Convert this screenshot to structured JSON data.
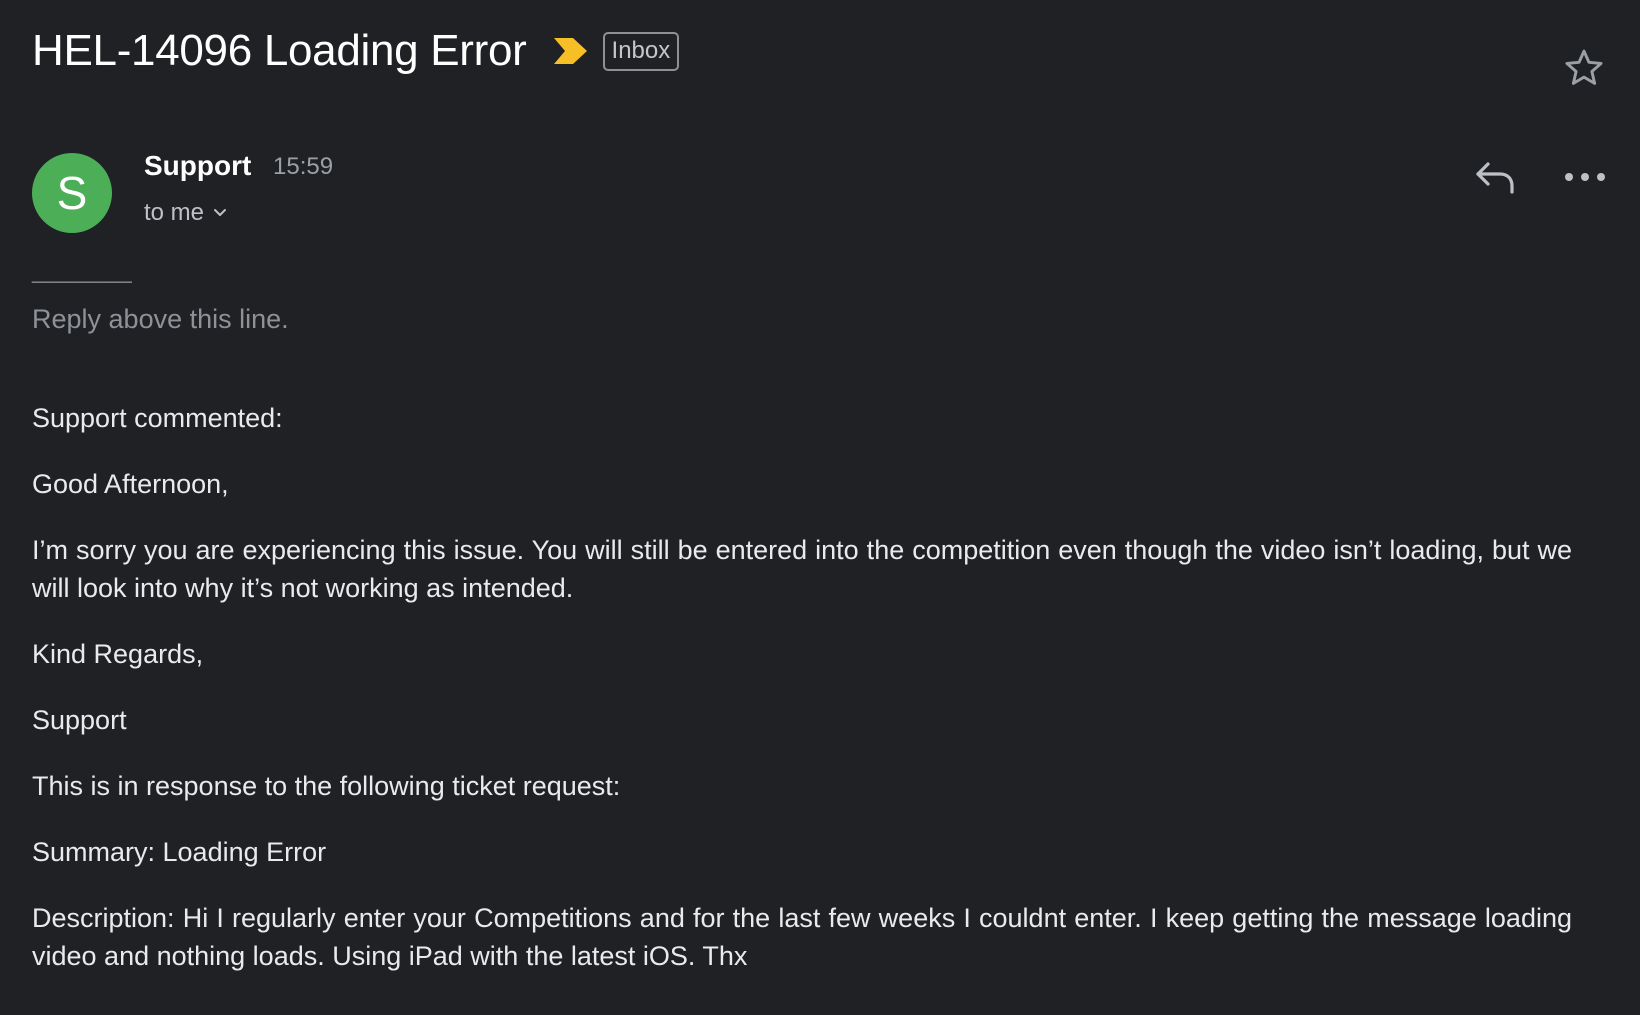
{
  "email": {
    "subject": "HEL-14096 Loading Error",
    "label": "Inbox",
    "importance_color": "#f6bf26",
    "sender": {
      "name": "Support",
      "initial": "S",
      "avatar_color": "#4caf58",
      "time": "15:59",
      "recipients": "to me"
    },
    "body": {
      "divider": "________",
      "reply_hint": "Reply above this line.",
      "paragraphs": [
        "Support commented:",
        "Good Afternoon,",
        "I’m sorry you are experiencing this issue. You will still be entered into the competition even though the video isn’t loading, but we will look into why it’s not working as intended.",
        "Kind Regards,",
        "Support",
        "This is in response to the following ticket request:",
        "Summary: Loading Error",
        "Description: Hi I regularly enter your Competitions and for the last few weeks I couldnt enter. I keep getting the message loading video and nothing loads. Using iPad with the latest iOS. Thx"
      ]
    }
  },
  "icons": {
    "star": "star-outline-icon",
    "importance": "importance-marker-icon",
    "chevron": "chevron-down-icon",
    "reply": "reply-icon",
    "more": "more-horizontal-icon"
  }
}
